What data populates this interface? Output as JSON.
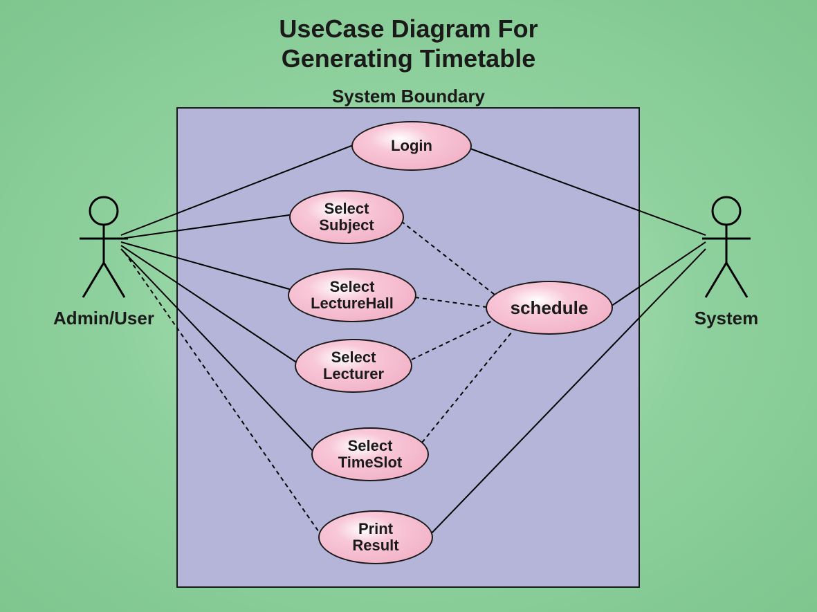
{
  "title": {
    "line1": "UseCase Diagram For",
    "line2": "Generating Timetable"
  },
  "boundary_label": "System Boundary",
  "actors": {
    "admin": {
      "label": "Admin/User"
    },
    "system": {
      "label": "System"
    }
  },
  "usecases": {
    "login": {
      "label": "Login"
    },
    "select_subject": {
      "line1": "Select",
      "line2": "Subject"
    },
    "select_lecturehall": {
      "line1": "Select",
      "line2": "LectureHall"
    },
    "select_lecturer": {
      "line1": "Select",
      "line2": "Lecturer"
    },
    "select_timeslot": {
      "line1": "Select",
      "line2": "TimeSlot"
    },
    "print_result": {
      "line1": "Print",
      "line2": "Result"
    },
    "schedule": {
      "label": "schedule"
    }
  }
}
